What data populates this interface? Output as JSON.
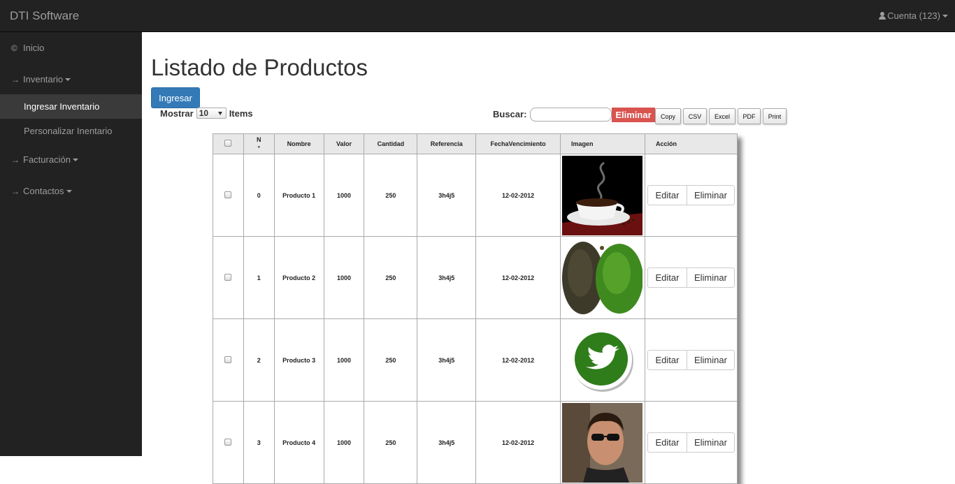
{
  "navbar": {
    "brand": "DTI Software",
    "account": "Cuenta (123)"
  },
  "sidebar": {
    "items": [
      {
        "icon": "copyright-icon",
        "label": "Inicio"
      },
      {
        "icon": "arrow-right-icon",
        "label": "Inventario",
        "expanded": true,
        "children": [
          {
            "label": "Ingresar Inventario",
            "active": true
          },
          {
            "label": "Personalizar Inentario"
          }
        ]
      },
      {
        "icon": "arrow-right-icon",
        "label": "Facturación"
      },
      {
        "icon": "arrow-right-icon",
        "label": "Contactos"
      }
    ]
  },
  "main": {
    "title": "Listado de Productos",
    "ingresar_label": "Ingresar",
    "mostrar_label": "Mostrar",
    "mostrar_value": "10",
    "items_label": "Items",
    "buscar_label": "Buscar:",
    "search_value": "",
    "eliminar_label": "Eliminar",
    "tools": [
      "Copy",
      "CSV",
      "Excel",
      "PDF",
      "Print"
    ]
  },
  "table": {
    "headers": {
      "num_top": "N",
      "num_bottom": "°",
      "nombre": "Nombre",
      "valor": "Valor",
      "cantidad": "Cantidad",
      "referencia": "Referencia",
      "fecha": "FechaVencimiento",
      "imagen": "Imagen",
      "accion": "Acción"
    },
    "rows": [
      {
        "num": "0",
        "nombre": "Producto 1",
        "valor": "1000",
        "cantidad": "250",
        "referencia": "3h4j5",
        "fecha": "12-02-2012",
        "image": "coffee-cup"
      },
      {
        "num": "1",
        "nombre": "Producto 2",
        "valor": "1000",
        "cantidad": "250",
        "referencia": "3h4j5",
        "fecha": "12-02-2012",
        "image": "avocados"
      },
      {
        "num": "2",
        "nombre": "Producto 3",
        "valor": "1000",
        "cantidad": "250",
        "referencia": "3h4j5",
        "fecha": "12-02-2012",
        "image": "twitter-logo"
      },
      {
        "num": "3",
        "nombre": "Producto 4",
        "valor": "1000",
        "cantidad": "250",
        "referencia": "3h4j5",
        "fecha": "12-02-2012",
        "image": "man-portrait"
      }
    ],
    "editar_label": "Editar",
    "eliminar_label": "Eliminar"
  },
  "colors": {
    "navbar": "#222222",
    "primary": "#337ab7",
    "danger": "#d9534f",
    "twitter_green": "#2e7d1a"
  }
}
